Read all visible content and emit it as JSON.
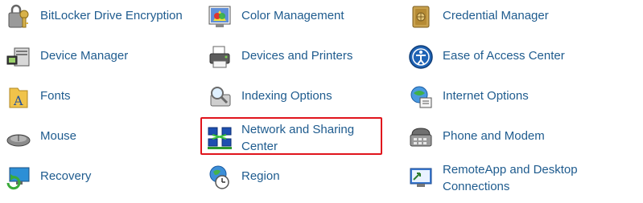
{
  "items": [
    {
      "label": "BitLocker Drive Encryption",
      "icon": "bitlocker-key-icon"
    },
    {
      "label": "Color Management",
      "icon": "color-management-icon"
    },
    {
      "label": "Credential Manager",
      "icon": "credential-vault-icon"
    },
    {
      "label": "Device Manager",
      "icon": "device-manager-icon"
    },
    {
      "label": "Devices and Printers",
      "icon": "printer-icon"
    },
    {
      "label": "Ease of Access Center",
      "icon": "ease-of-access-icon"
    },
    {
      "label": "Fonts",
      "icon": "fonts-folder-icon"
    },
    {
      "label": "Indexing Options",
      "icon": "indexing-magnifier-icon"
    },
    {
      "label": "Internet Options",
      "icon": "internet-options-icon"
    },
    {
      "label": "Mouse",
      "icon": "mouse-icon"
    },
    {
      "label_line1": "Network and Sharing",
      "label_line2": "Center",
      "icon": "network-icon"
    },
    {
      "label": "Phone and Modem",
      "icon": "phone-modem-icon"
    },
    {
      "label": "Recovery",
      "icon": "recovery-icon"
    },
    {
      "label": "Region",
      "icon": "region-globe-icon"
    },
    {
      "label_line1": "RemoteApp and Desktop",
      "label_line2": "Connections",
      "icon": "remote-desktop-icon"
    }
  ],
  "highlighted_item": "Network and Sharing Center",
  "colors": {
    "link_text": "#1e5b8e",
    "highlight_border": "#e0141c"
  }
}
